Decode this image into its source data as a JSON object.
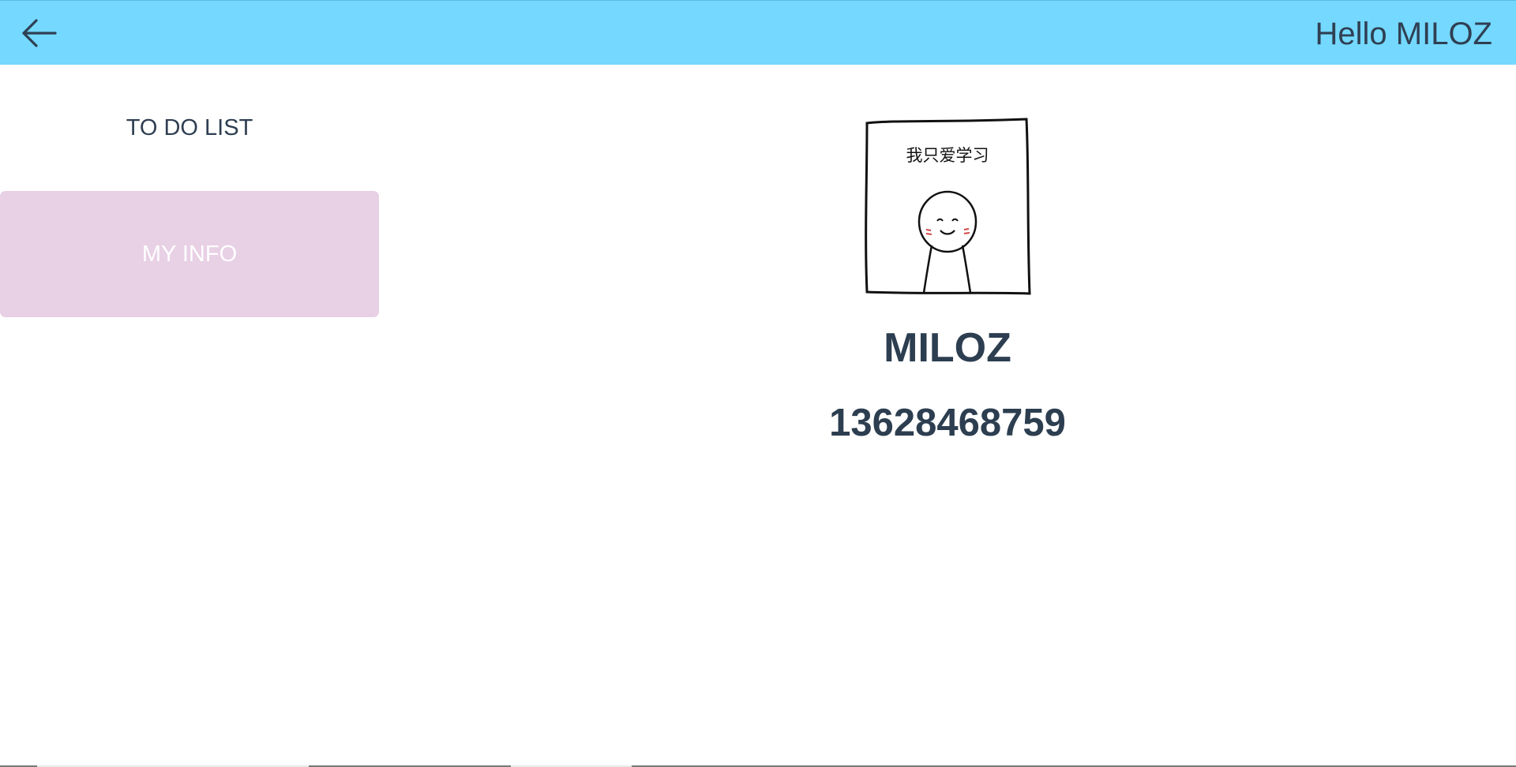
{
  "header": {
    "back_icon": "arrow-left-icon",
    "greeting": "Hello MILOZ",
    "background_color": "#74d8ff"
  },
  "sidebar": {
    "items": [
      {
        "label": "TO DO LIST",
        "active": false
      },
      {
        "label": "MY INFO",
        "active": true,
        "active_color": "#e8d0e5"
      }
    ]
  },
  "profile": {
    "avatar_caption": "我只爱学习",
    "name": "MILOZ",
    "phone": "13628468759"
  }
}
